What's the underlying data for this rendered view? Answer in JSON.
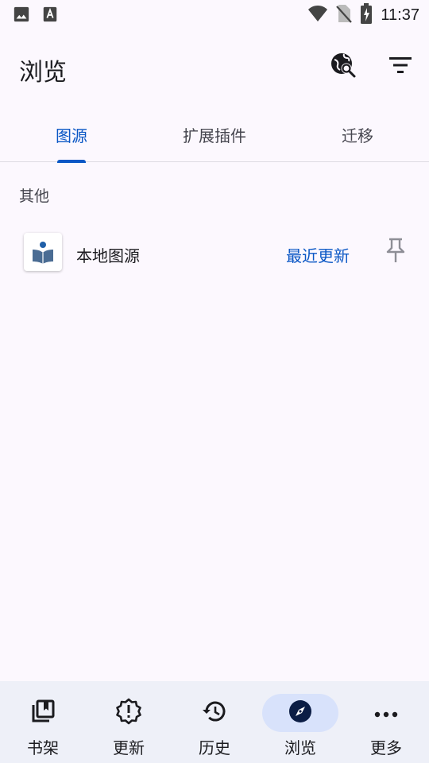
{
  "status_bar": {
    "time": "11:37",
    "left_icons": [
      "image-icon",
      "a-font-icon"
    ],
    "right_icons": [
      "wifi-icon",
      "no-sim-icon",
      "battery-charging-icon"
    ]
  },
  "header": {
    "title": "浏览",
    "actions": [
      {
        "icon": "global-search-icon"
      },
      {
        "icon": "filter-icon"
      }
    ]
  },
  "tabs": [
    {
      "label": "图源",
      "active": true
    },
    {
      "label": "扩展插件",
      "active": false
    },
    {
      "label": "迁移",
      "active": false
    }
  ],
  "sections": [
    {
      "header": "其他",
      "items": [
        {
          "name": "本地图源",
          "action_label": "最近更新",
          "icon": "book-reader-icon",
          "pin_icon": "pin-icon"
        }
      ]
    }
  ],
  "bottom_nav": [
    {
      "label": "书架",
      "icon": "library-icon",
      "active": false
    },
    {
      "label": "更新",
      "icon": "updates-icon",
      "active": false
    },
    {
      "label": "历史",
      "icon": "history-icon",
      "active": false
    },
    {
      "label": "浏览",
      "icon": "compass-icon",
      "active": true
    },
    {
      "label": "更多",
      "icon": "more-icon",
      "active": false
    }
  ],
  "colors": {
    "accent": "#0a57c5",
    "background": "#fcf8fe",
    "nav_background": "#eef0f8",
    "nav_active_pill": "#d8e2fb"
  }
}
